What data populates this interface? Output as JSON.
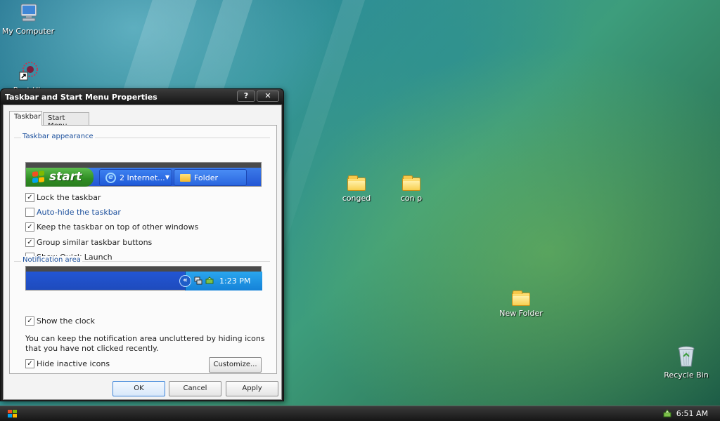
{
  "desktop": {
    "icons": {
      "my_computer": "My Computer",
      "partial_second": "Rest Uh",
      "conged": "conged",
      "con_p": "con p",
      "new_folder": "New Folder",
      "recycle_bin": "Recycle Bin"
    }
  },
  "dialog": {
    "title": "Taskbar and Start Menu Properties",
    "help_label": "?",
    "close_label": "✕",
    "tabs": [
      "Taskbar",
      "Start Menu"
    ],
    "taskbar_appearance": {
      "heading": "Taskbar appearance",
      "preview": {
        "start_label": "start",
        "ie_button": "2 Internet...",
        "folder_button": "Folder"
      },
      "options": [
        {
          "label": "Lock the taskbar",
          "checked": true
        },
        {
          "label": "Auto-hide the taskbar",
          "checked": false
        },
        {
          "label": "Keep the taskbar on top of other windows",
          "checked": true
        },
        {
          "label": "Group similar taskbar buttons",
          "checked": true
        },
        {
          "label": "Show Quick Launch",
          "checked": false
        }
      ]
    },
    "notification_area": {
      "heading": "Notification area",
      "preview_time": "1:23 PM",
      "show_clock": {
        "label": "Show the clock",
        "checked": true
      },
      "note": "You can keep the notification area uncluttered by hiding icons that you have not clicked recently.",
      "hide_inactive": {
        "label": "Hide inactive icons",
        "checked": true
      },
      "customize_label": "Customize..."
    },
    "buttons": {
      "ok": "OK",
      "cancel": "Cancel",
      "apply": "Apply"
    }
  },
  "taskbar": {
    "clock": "6:51 AM"
  },
  "colors": {
    "accent_blue": "#1b4f9c",
    "xp_green": "#2e8d22",
    "xp_blue": "#2356d4"
  }
}
